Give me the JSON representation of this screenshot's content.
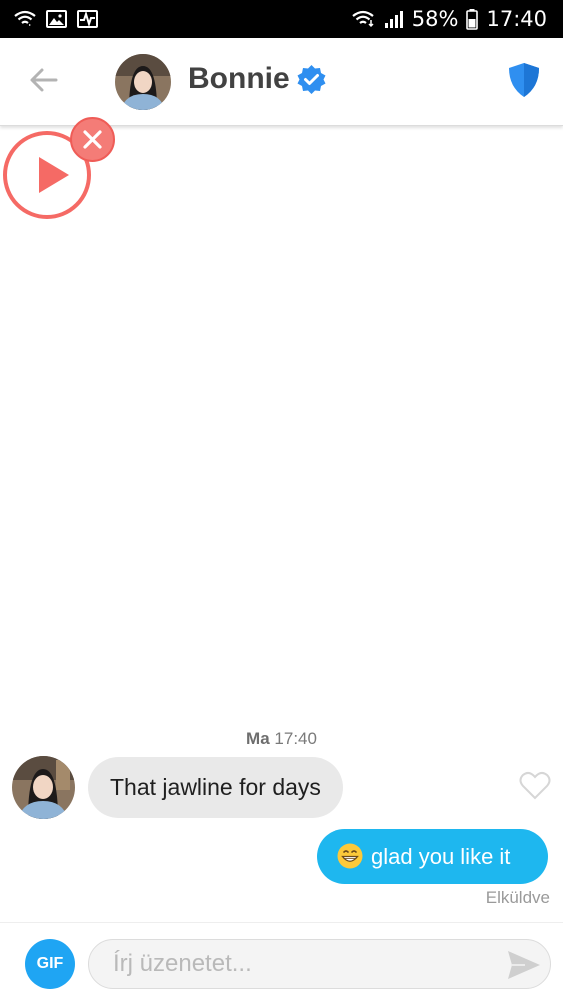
{
  "status_bar": {
    "battery": "58%",
    "time": "17:40",
    "icons": [
      "wifi-calling-icon",
      "gallery-icon",
      "activity-icon",
      "wifi-signal-icon",
      "cell-signal-icon",
      "battery-icon"
    ]
  },
  "header": {
    "contact_name": "Bonnie",
    "back_icon": "arrow-left-icon",
    "verified_icon": "verified-badge-icon",
    "safety_icon": "shield-icon"
  },
  "floating_video": {
    "play_icon": "play-icon",
    "close_icon": "close-icon"
  },
  "conversation": {
    "timestamp_day": "Ma",
    "timestamp_time": "17:40",
    "messages": [
      {
        "direction": "incoming",
        "text": "That jawline for days"
      },
      {
        "direction": "outgoing",
        "emoji": "grinning-face-emoji",
        "text": "glad you like it",
        "status": "Elküldve"
      }
    ],
    "like_icon": "heart-outline-icon"
  },
  "composer": {
    "gif_label": "GIF",
    "placeholder": "Írj üzenetet...",
    "send_icon": "send-icon"
  },
  "colors": {
    "outgoing_bubble": "#1eb7ef",
    "incoming_bubble": "#e9e9e9",
    "accent_red": "#f56a65",
    "gif_button": "#1fa5f3",
    "verified_blue": "#2f8ff0"
  }
}
